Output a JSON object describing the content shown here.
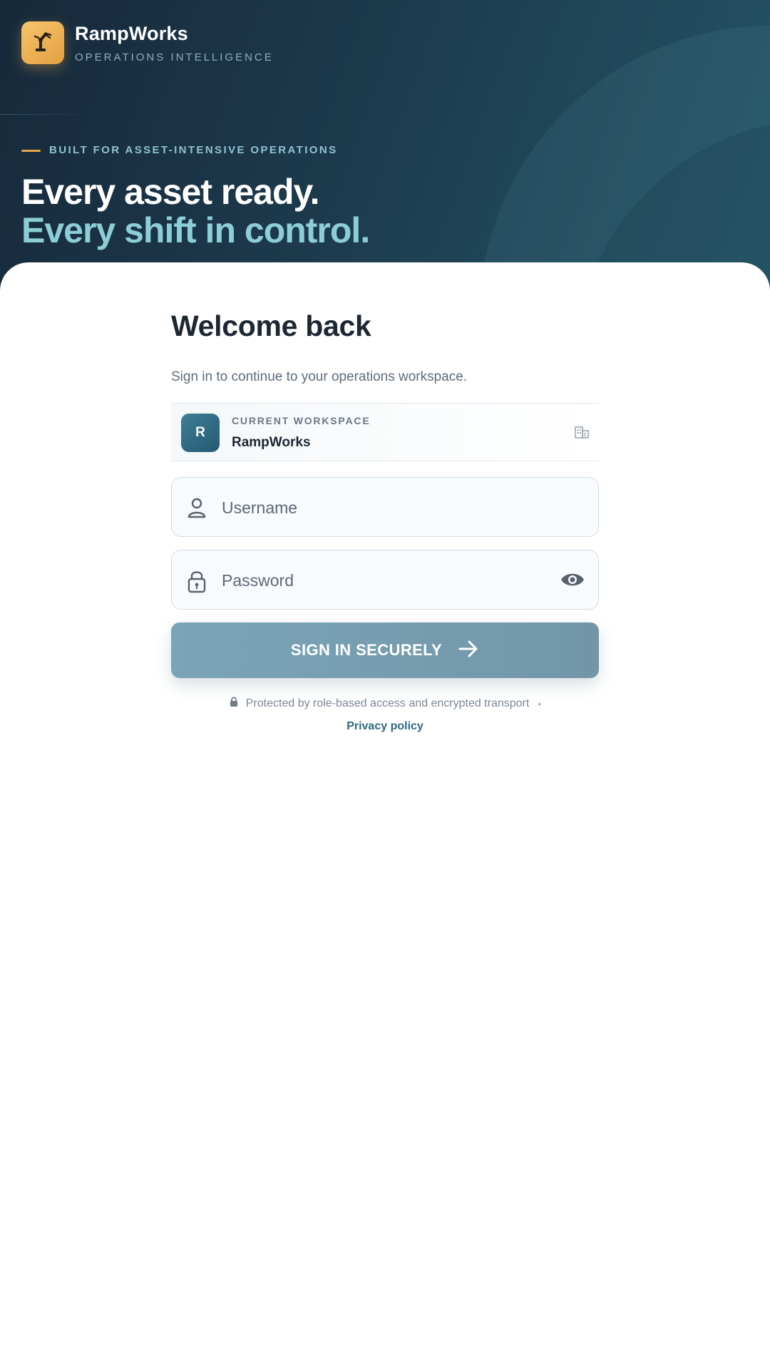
{
  "brand": {
    "name": "RampWorks",
    "tagline": "OPERATIONS INTELLIGENCE",
    "logo_icon": "robot-arm-icon"
  },
  "hero": {
    "eyebrow": "BUILT FOR ASSET-INTENSIVE OPERATIONS",
    "headline_line1": "Every asset ready.",
    "headline_line2": "Every shift in control."
  },
  "login": {
    "title": "Welcome back",
    "subtitle": "Sign in to continue to your operations workspace.",
    "workspace": {
      "label": "CURRENT WORKSPACE",
      "name": "RampWorks",
      "avatar_letter": "R",
      "icon": "building-icon"
    },
    "username": {
      "placeholder": "Username",
      "value": "",
      "icon": "user-icon"
    },
    "password": {
      "placeholder": "Password",
      "value": "",
      "icon": "lock-icon",
      "toggle_icon": "eye-icon"
    },
    "submit_label": "SIGN IN SECURELY",
    "submit_icon": "arrow-right-icon",
    "security_note": "Protected by role-based access and encrypted transport",
    "separator": "•",
    "privacy_link": "Privacy policy"
  },
  "colors": {
    "hero_bg": "#1d3a4d",
    "accent_amber": "#e8a647",
    "accent_teal": "#8ccdd6",
    "button": "#7aa5b7",
    "link": "#2e6a80"
  }
}
